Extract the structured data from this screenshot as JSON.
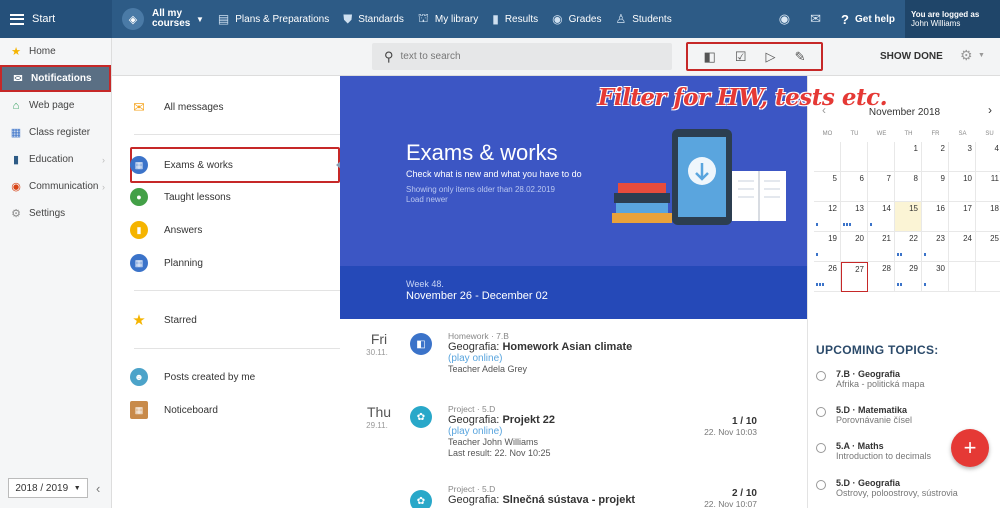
{
  "topbar": {
    "start_label": "Start",
    "courses_label": "All my courses",
    "nav": [
      "Plans & Preparations",
      "Standards",
      "My library",
      "Results",
      "Grades",
      "Students"
    ],
    "nav_icons": [
      "briefcase-icon",
      "shield-icon",
      "library-icon",
      "bar-chart-icon",
      "grades-icon",
      "students-icon"
    ],
    "help_label": "Get help",
    "logged_as_label": "You are logged as",
    "user_name": "John Williams",
    "bg_color": "#2d5b86"
  },
  "sidebar": {
    "items": [
      {
        "label": "Home",
        "icon": "star-icon"
      },
      {
        "label": "Notifications",
        "icon": "envelope-icon",
        "active": true
      },
      {
        "label": "Web page",
        "icon": "home-icon"
      },
      {
        "label": "Class register",
        "icon": "register-icon"
      },
      {
        "label": "Education",
        "icon": "education-icon"
      },
      {
        "label": "Communication",
        "icon": "communication-icon"
      },
      {
        "label": "Settings",
        "icon": "settings-icon"
      }
    ],
    "school_year": "2018 / 2019"
  },
  "search": {
    "placeholder": "text to search"
  },
  "toolbar": {
    "show_done_label": "SHOW DONE"
  },
  "annotation": "Filter for HW, tests etc.",
  "categories": [
    {
      "label": "All messages",
      "icon": "envelope-icon",
      "color": "#f5a623"
    },
    {
      "label": "Exams & works",
      "icon": "exam-icon",
      "color": "#3b73c9"
    },
    {
      "label": "Taught lessons",
      "icon": "lesson-icon",
      "color": "#43a047"
    },
    {
      "label": "Answers",
      "icon": "answers-icon",
      "color": "#f5b400"
    },
    {
      "label": "Planning",
      "icon": "planning-icon",
      "color": "#3b73c9"
    },
    {
      "label": "Starred",
      "icon": "star-icon",
      "color": "#f5b400"
    },
    {
      "label": "Posts created by me",
      "icon": "posts-icon",
      "color": "#4ca3c9"
    },
    {
      "label": "Noticeboard",
      "icon": "noticeboard-icon",
      "color": "#c88a4a"
    }
  ],
  "hero": {
    "title": "Exams & works",
    "subtitle": "Check what is new and what you have to do",
    "note": "Showing only items older than 28.02.2019",
    "load_newer": "Load newer",
    "bg_color": "#3c56c4"
  },
  "week": {
    "label": "Week 48.",
    "range": "November 26 - December 02"
  },
  "entries": [
    {
      "day": "Fri",
      "date": "30.11.",
      "type": "Homework · 7.B",
      "subject": "Geografia:",
      "title": "Homework Asian climate",
      "link": "(play online)",
      "teacher": "Teacher Adela Grey",
      "extra": "",
      "score": "",
      "score_date": "",
      "icon_color": "#3b73c9"
    },
    {
      "day": "Thu",
      "date": "29.11.",
      "type": "Project · 5.D",
      "subject": "Geografia:",
      "title": "Projekt 22",
      "link": "(play online)",
      "teacher": "Teacher John Williams",
      "extra": "Last result: 22. Nov 10:25",
      "score": "1 / 10",
      "score_date": "22. Nov 10:03",
      "icon_color": "#29a8c9"
    },
    {
      "day": "",
      "date": "",
      "type": "Project · 5.D",
      "subject": "Geografia:",
      "title": "Slnečná sústava - projekt",
      "link": "",
      "teacher": "",
      "extra": "",
      "score": "2 / 10",
      "score_date": "22. Nov 10:07",
      "icon_color": "#29a8c9"
    }
  ],
  "calendar": {
    "month": "November 2018",
    "dow": [
      "MO",
      "TU",
      "WE",
      "TH",
      "FR",
      "SA",
      "SU"
    ],
    "weeks": [
      [
        "",
        "",
        "",
        "1",
        "2",
        "3",
        "4"
      ],
      [
        "5",
        "6",
        "7",
        "8",
        "9",
        "10",
        "11"
      ],
      [
        "12",
        "13",
        "14",
        "15",
        "16",
        "17",
        "18"
      ],
      [
        "19",
        "20",
        "21",
        "22",
        "23",
        "24",
        "25"
      ],
      [
        "26",
        "27",
        "28",
        "29",
        "30",
        "",
        ""
      ]
    ],
    "today": "15",
    "selected": "27"
  },
  "upcoming": {
    "heading": "UPCOMING TOPICS:",
    "items": [
      {
        "title": "7.B · Geografia",
        "sub": "Afrika - politická mapa"
      },
      {
        "title": "5.D · Matematika",
        "sub": "Porovnávanie čísel"
      },
      {
        "title": "5.A · Maths",
        "sub": "Introduction to decimals"
      },
      {
        "title": "5.D · Geografia",
        "sub": "Ostrovy, poloostrovy, sústrovia"
      }
    ]
  },
  "accent_color": "#c62828"
}
